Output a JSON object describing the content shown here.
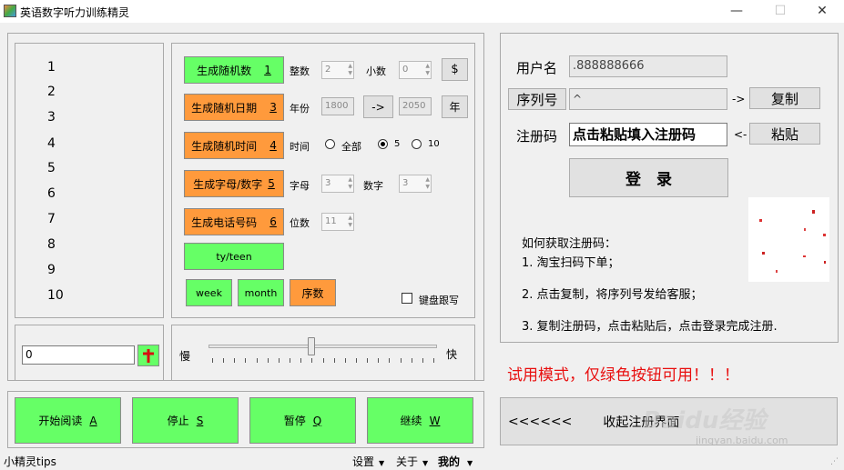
{
  "window": {
    "title": "英语数字听力训练精灵",
    "minimize": "—",
    "maximize": "☐",
    "close": "✕"
  },
  "numbers": [
    "1",
    "2",
    "3",
    "4",
    "5",
    "6",
    "7",
    "8",
    "9",
    "10"
  ],
  "generators": {
    "rand_number": {
      "label": "生成随机数",
      "key": "1",
      "int_label": "整数",
      "int_val": "2",
      "dec_label": "小数",
      "dec_val": "0",
      "go": "$"
    },
    "rand_date": {
      "label": "生成随机日期",
      "key": "3",
      "year_label": "年份",
      "from": "1800",
      "arrow": "->",
      "to": "2050",
      "go": "年"
    },
    "rand_time": {
      "label": "生成随机时间",
      "key": "4",
      "time_label": "时间",
      "opt_all": "全部",
      "opt_5": "5",
      "opt_10": "10"
    },
    "rand_alnum": {
      "label": "生成字母/数字",
      "key": "5",
      "letter_label": "字母",
      "letter_val": "3",
      "digit_label": "数字",
      "digit_val": "3"
    },
    "rand_phone": {
      "label": "生成电话号码",
      "key": "6",
      "digits_label": "位数",
      "digits_val": "11"
    },
    "ty_teen": "ty/teen",
    "week": "week",
    "month": "month",
    "ordinal": "序数",
    "keyboard_follow": "键盘跟写"
  },
  "answer": {
    "value": "0"
  },
  "speed": {
    "slow": "慢",
    "fast": "快",
    "value": 0.45
  },
  "controls": {
    "start": {
      "label": "开始阅读",
      "key": "A"
    },
    "stop": {
      "label": "停止",
      "key": "S"
    },
    "pause": {
      "label": "暂停",
      "key": "Q"
    },
    "resume": {
      "label": "继续",
      "key": "W"
    }
  },
  "register": {
    "user_label": "用户名",
    "user_value": ".888888666",
    "serial_label": "序列号",
    "serial_value": "^",
    "copy_arrow": "->",
    "copy": "复制",
    "code_label": "注册码",
    "code_value": "点击粘贴填入注册码",
    "paste_arrow": "<-",
    "paste": "粘贴",
    "login": "登　录",
    "howto_title": "如何获取注册码：",
    "step1": "1. 淘宝扫码下单；",
    "step2": "2. 点击复制，将序列号发给客服；",
    "step3": "3. 复制注册码，点击粘贴后，点击登录完成注册."
  },
  "trial_notice": "试用模式，仅绿色按钮可用！！！",
  "collapse": {
    "arrows": "<<<<<<",
    "label": "收起注册界面"
  },
  "statusbar": {
    "tips": "小精灵tips",
    "settings": "设置",
    "about": "关于",
    "mine": "我的"
  },
  "watermark": {
    "brand": "Baidu经验",
    "url": "jingyan.baidu.com"
  },
  "colors": {
    "green": "#66ff66",
    "orange": "#ff9a3c",
    "trial_red": "#e81010"
  }
}
